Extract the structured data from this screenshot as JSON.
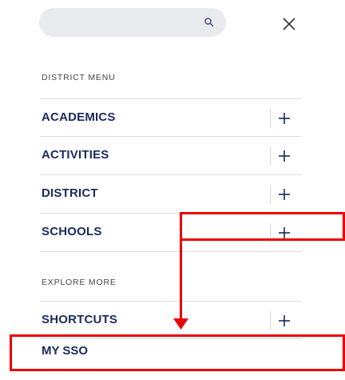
{
  "search": {
    "placeholder": "",
    "icon": "search-icon"
  },
  "close": {
    "icon": "close-icon"
  },
  "district_menu": {
    "heading": "DISTRICT MENU",
    "items": [
      {
        "label": "ACADEMICS"
      },
      {
        "label": "ACTIVITIES"
      },
      {
        "label": "DISTRICT"
      },
      {
        "label": "SCHOOLS"
      }
    ]
  },
  "explore_more": {
    "heading": "EXPLORE MORE",
    "items": [
      {
        "label": "SHORTCUTS"
      }
    ]
  },
  "my_sso": {
    "label": "MY SSO"
  },
  "colors": {
    "text": "#1a2a5c",
    "annotation": "#ec0000",
    "search_bg": "#e9eaee"
  }
}
